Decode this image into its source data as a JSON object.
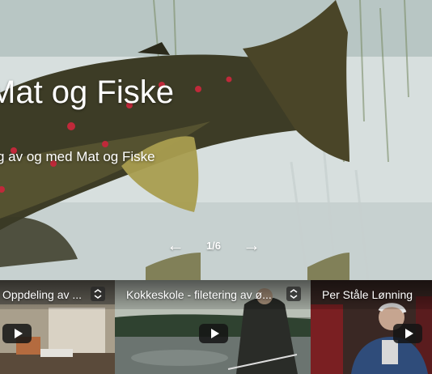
{
  "hero": {
    "title": "Mat og Fiske",
    "subtitle": "g av og med Mat og Fiske",
    "pager": {
      "prev_icon": "arrow-left-icon",
      "next_icon": "arrow-right-icon",
      "current": "1/6"
    }
  },
  "videos": [
    {
      "title": "Oppdeling av ..."
    },
    {
      "title": "Kokkeskole - filetering av ø..."
    },
    {
      "title": "Per Ståle Lønning"
    }
  ],
  "colors": {
    "overlay": "#000000",
    "text": "#ffffff",
    "fish_body": "#3a3a24",
    "fish_spots": "#c0293a"
  }
}
